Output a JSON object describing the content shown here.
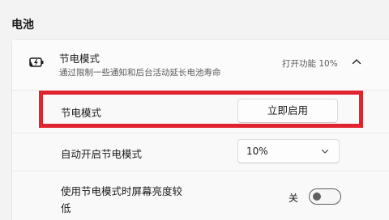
{
  "section_title": "电池",
  "battery_saver": {
    "icon": "battery-saver-icon",
    "title": "节电模式",
    "description": "通过限制一些通知和后台活动延长电池寿命",
    "status": "打开功能 10%",
    "expanded": true
  },
  "rows": {
    "saver_now": {
      "label": "节电模式",
      "button_label": "立即启用"
    },
    "auto_on": {
      "label": "自动开启节电模式",
      "selected": "10%"
    },
    "lower_brightness": {
      "label_line1": "使用节电模式时屏幕亮度较",
      "label_line2": "低",
      "toggle_state": "关",
      "toggle_on": false
    }
  },
  "colors": {
    "highlight": "#e0232f",
    "background": "#f3f3f3",
    "card": "#f9f9f9"
  }
}
